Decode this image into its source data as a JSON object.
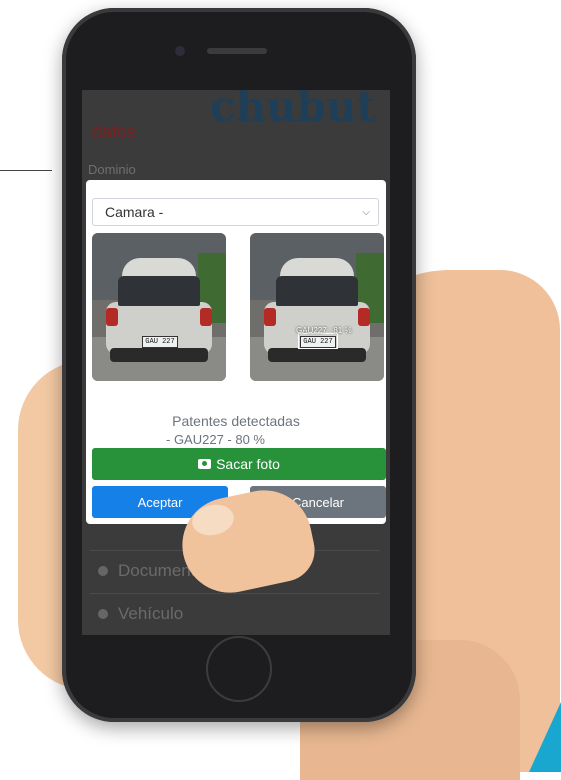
{
  "background": {
    "logo_text": "chubut",
    "section_title": "datos",
    "field_label": "Dominio",
    "accordion": [
      {
        "label": "Documento"
      },
      {
        "label": "Vehículo"
      }
    ]
  },
  "modal": {
    "camera_select": {
      "value": "Camara -"
    },
    "photos": [
      {
        "name": "original",
        "plate_text": "GAU 227"
      },
      {
        "name": "detected",
        "plate_text": "GAU 227",
        "detection_label": "GAU227 : 81 %"
      }
    ],
    "detected_title": "Patentes detectadas",
    "detected_items": [
      "- GAU227 - 80 %"
    ],
    "take_photo_label": "Sacar foto",
    "accept_label": "Aceptar",
    "cancel_label": "Cancelar"
  },
  "colors": {
    "take_photo": "#28923b",
    "accept": "#1480e8",
    "cancel": "#6c757d",
    "accent": "#1aa7cf"
  }
}
